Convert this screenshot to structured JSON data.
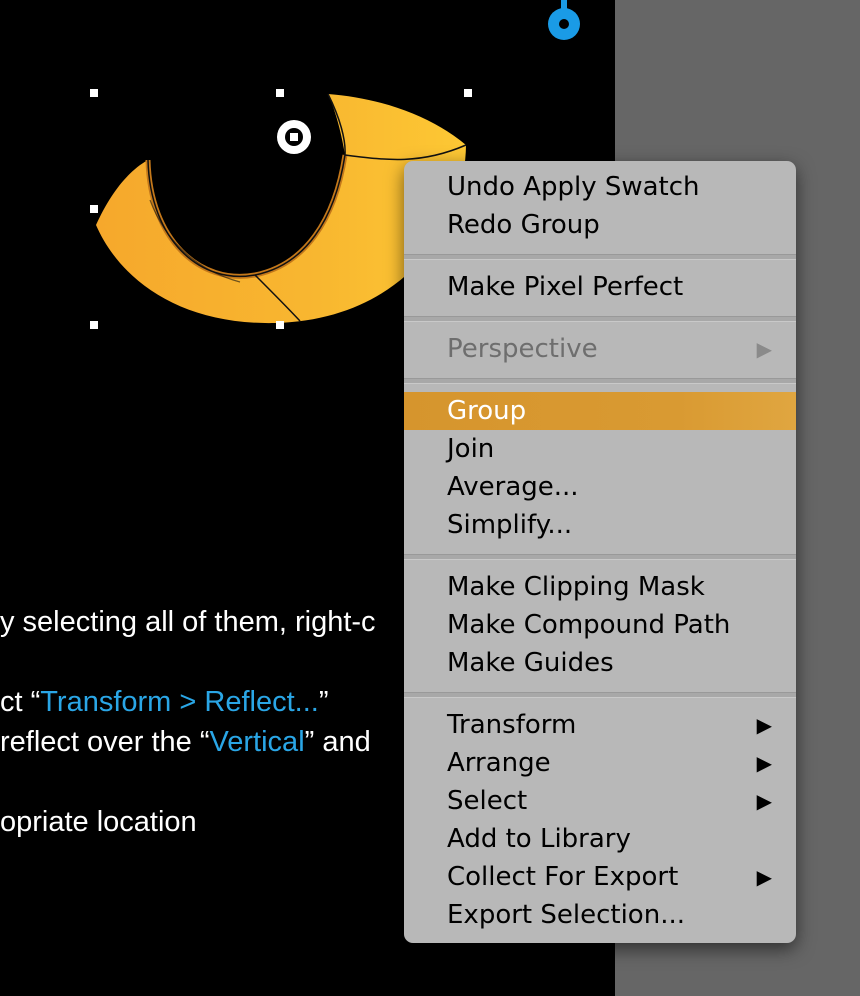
{
  "instructions": {
    "line1": "y selecting all of them, right-c",
    "line2_pre": "ct “",
    "line2_hl": "Transform > Reflect...",
    "line2_post": "”",
    "line3_pre": " reflect over the “",
    "line3_hl": "Vertical",
    "line3_post": "” and",
    "line4": "opriate location"
  },
  "context_menu": {
    "items": [
      {
        "label": "Undo Apply Swatch"
      },
      {
        "label": "Redo Group"
      },
      {
        "label": "Make Pixel Perfect"
      },
      {
        "label": "Perspective",
        "arrow": "▶",
        "disabled": true
      },
      {
        "label": "Group",
        "selected": true
      },
      {
        "label": "Join"
      },
      {
        "label": "Average..."
      },
      {
        "label": "Simplify..."
      },
      {
        "label": "Make Clipping Mask"
      },
      {
        "label": "Make Compound Path"
      },
      {
        "label": "Make Guides"
      },
      {
        "label": "Transform",
        "arrow": "▶"
      },
      {
        "label": "Arrange",
        "arrow": "▶"
      },
      {
        "label": "Select",
        "arrow": "▶"
      },
      {
        "label": "Add to Library"
      },
      {
        "label": "Collect For Export",
        "arrow": "▶"
      },
      {
        "label": "Export Selection..."
      }
    ]
  },
  "colors": {
    "canvas": "#000000",
    "pasteboard": "#666666",
    "menu_bg": "#b8b8b8",
    "highlight": "#d99a32",
    "link_blue": "#2aa6e6",
    "shape_orange": "#f7b02e",
    "anchor_blue": "#1a9be6"
  }
}
